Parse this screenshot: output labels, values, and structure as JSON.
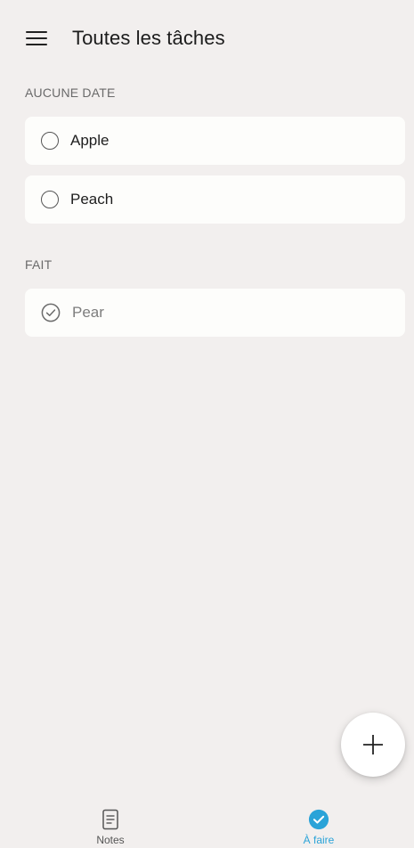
{
  "header": {
    "title": "Toutes les tâches"
  },
  "sections": [
    {
      "label": "AUCUNE DATE",
      "tasks": [
        {
          "text": "Apple",
          "done": false
        },
        {
          "text": "Peach",
          "done": false
        }
      ]
    },
    {
      "label": "FAIT",
      "tasks": [
        {
          "text": "Pear",
          "done": true
        }
      ]
    }
  ],
  "fab": {
    "icon": "plus-icon"
  },
  "bottom_nav": {
    "items": [
      {
        "label": "Notes",
        "icon": "notes-icon",
        "active": false
      },
      {
        "label": "À faire",
        "icon": "check-circle-icon",
        "active": true
      }
    ]
  },
  "colors": {
    "background": "#f2efee",
    "card": "#fdfdfb",
    "accent": "#2aa3d8"
  }
}
